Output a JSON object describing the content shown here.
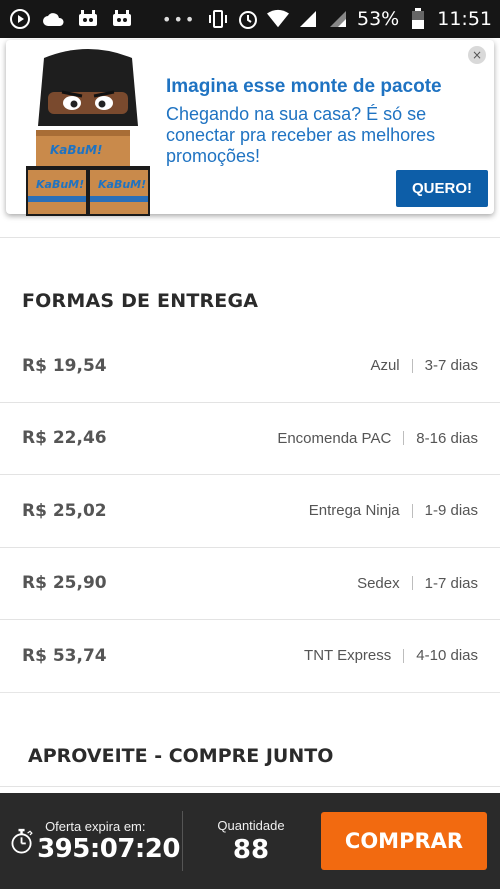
{
  "status_bar": {
    "battery": "53%",
    "time": "11:51",
    "icons_left": [
      "play-circle-icon",
      "cloud-icon",
      "bot-icon",
      "bot-icon"
    ],
    "icons_right": [
      "vibrate-icon",
      "alarm-icon",
      "wifi-icon",
      "signal-icon",
      "signal-icon",
      "battery-icon"
    ]
  },
  "popup": {
    "title": "Imagina esse monte de pacote",
    "text": "Chegando na sua casa? É só se conectar pra receber as melhores promoções!",
    "cta": "QUERO!",
    "close": "×",
    "mascot_box_label": "KaBuM!",
    "accent_color": "#1f73c2"
  },
  "delivery": {
    "title": "FORMAS DE ENTREGA",
    "options": [
      {
        "price": "R$ 19,54",
        "carrier": "Azul",
        "days": "3-7 dias"
      },
      {
        "price": "R$ 22,46",
        "carrier": "Encomenda PAC",
        "days": "8-16 dias"
      },
      {
        "price": "R$ 25,02",
        "carrier": "Entrega Ninja",
        "days": "1-9 dias"
      },
      {
        "price": "R$ 25,90",
        "carrier": "Sedex",
        "days": "1-7 dias"
      },
      {
        "price": "R$ 53,74",
        "carrier": "TNT Express",
        "days": "4-10 dias"
      }
    ]
  },
  "combo": {
    "title": "APROVEITE - COMPRE JUNTO"
  },
  "bottom_bar": {
    "timer_label": "Oferta expira em:",
    "timer_value": "395:07:20",
    "quantity_label": "Quantidade",
    "quantity_value": "88",
    "buy_label": "COMPRAR",
    "buy_color": "#f26a10"
  }
}
